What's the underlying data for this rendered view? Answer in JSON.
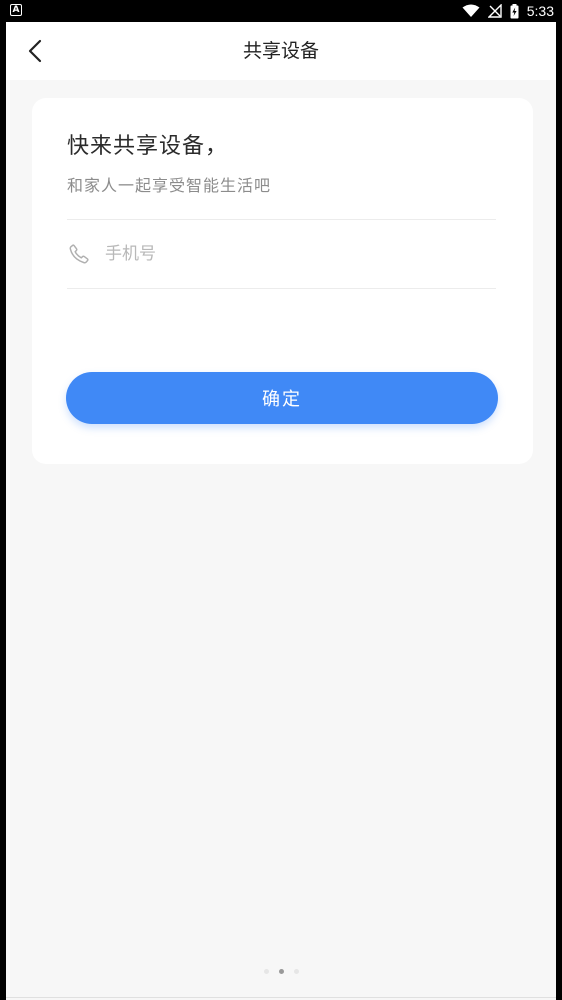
{
  "status_bar": {
    "time": "5:33",
    "notification_icon": "a-notification-icon",
    "icons": [
      "wifi-icon",
      "signal-icon",
      "battery-charging-icon"
    ]
  },
  "nav": {
    "title": "共享设备",
    "back_icon": "chevron-left-icon"
  },
  "card": {
    "heading": "快来共享设备，",
    "subtitle": "和家人一起享受智能生活吧",
    "phone_input": {
      "icon": "phone-icon",
      "placeholder": "手机号",
      "value": ""
    },
    "confirm_label": "确定"
  },
  "page_indicator": {
    "count": 3,
    "active_index": 1
  },
  "colors": {
    "accent": "#4089f6",
    "background": "#f7f7f7",
    "card": "#ffffff"
  }
}
